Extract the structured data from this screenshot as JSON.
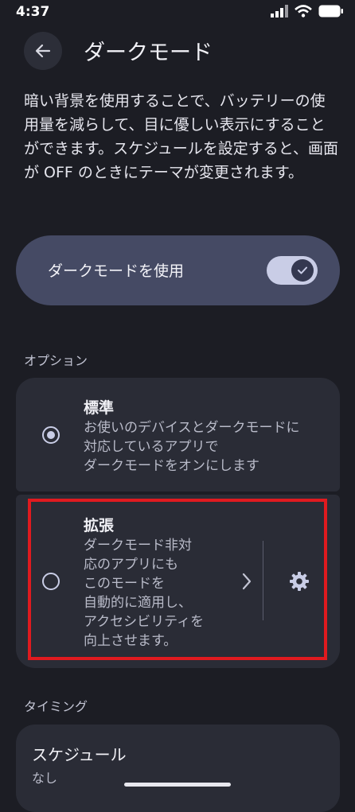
{
  "status_bar": {
    "time": "4:37"
  },
  "header": {
    "title": "ダークモード"
  },
  "description": "暗い背景を使用することで、バッテリーの使用量を減らして、目に優しい表示にすることができます。スケジュールを設定すると、画面が OFF のときにテーマが変更されます。",
  "main_toggle": {
    "label": "ダークモードを使用",
    "enabled": true
  },
  "options_section": {
    "label": "オプション",
    "standard": {
      "title": "標準",
      "description": "お使いのデバイスとダークモードに\n対応しているアプリで\nダークモードをオンにします",
      "selected": true
    },
    "extended": {
      "title": "拡張",
      "description": "ダークモード非対\n応のアプリにも\nこのモードを\n自動的に適用し、\nアクセシビリティを\n向上させます。",
      "selected": false
    }
  },
  "timing_section": {
    "label": "タイミング",
    "schedule": {
      "title": "スケジュール",
      "value": "なし"
    }
  },
  "colors": {
    "background": "#1c1d24",
    "card": "#2a2c36",
    "toggle_card": "#454a64",
    "accent": "#c9cde6",
    "highlight": "#e01a1f"
  }
}
